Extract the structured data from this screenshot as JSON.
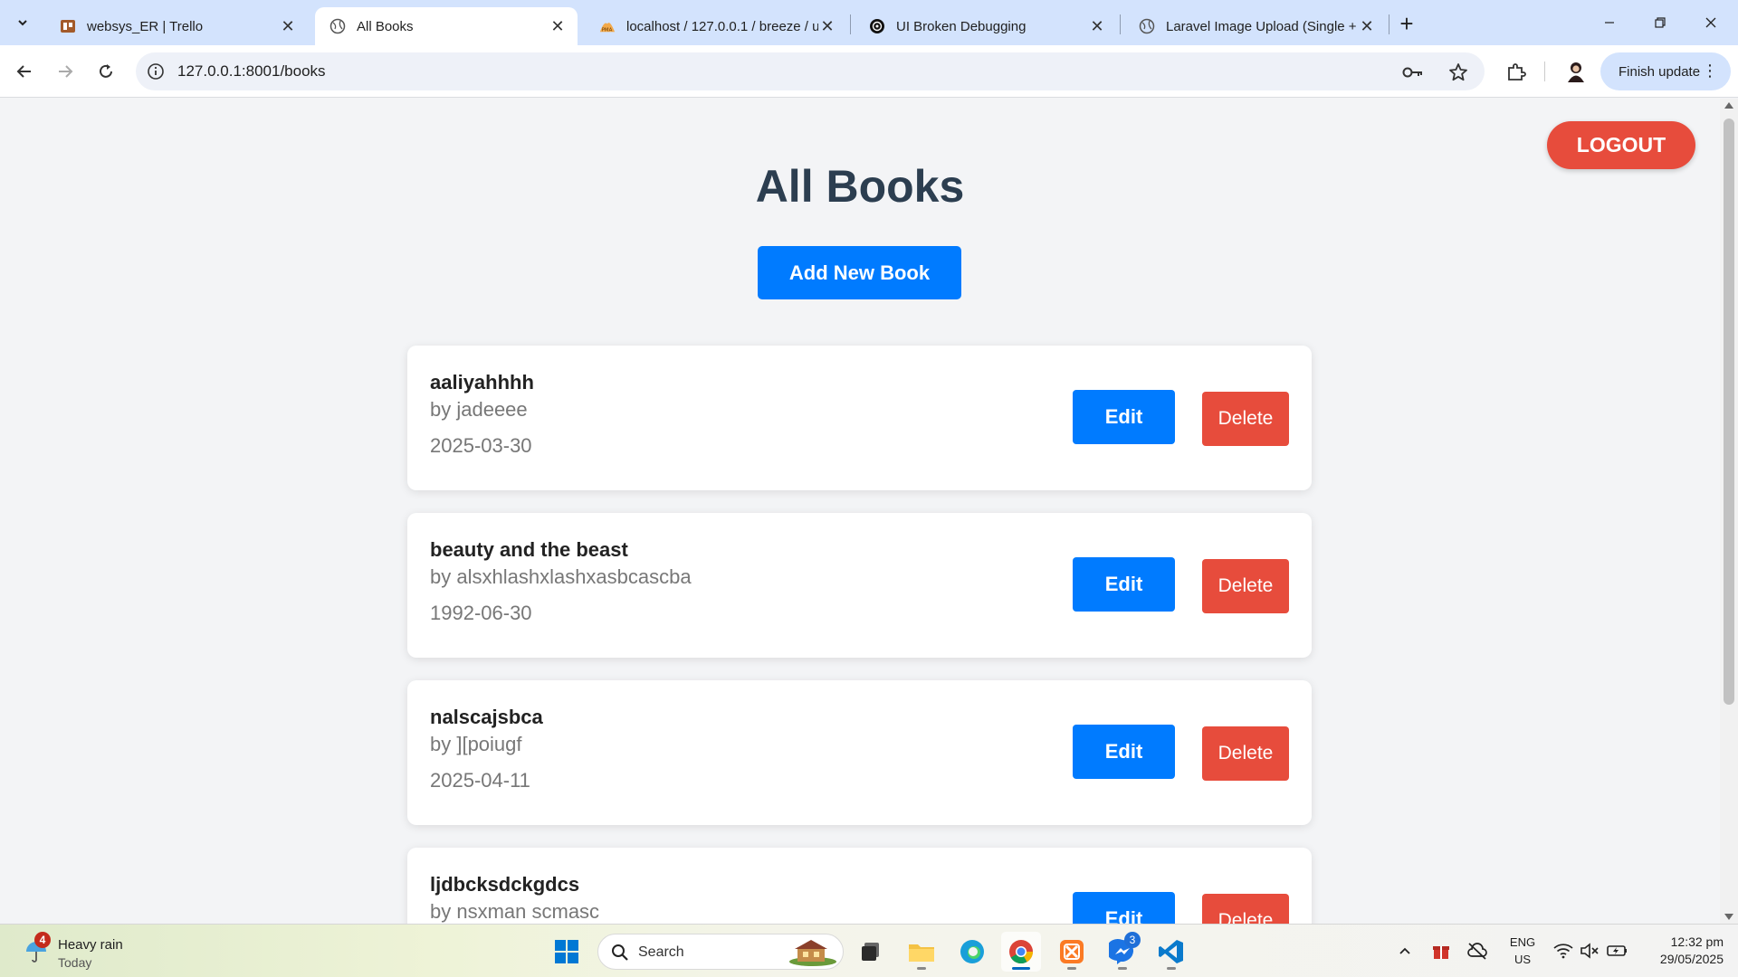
{
  "browser": {
    "tabs": [
      {
        "title": "websys_ER | Trello",
        "icon": "trello-icon"
      },
      {
        "title": "All Books",
        "icon": "globe-icon",
        "active": true
      },
      {
        "title": "localhost / 127.0.0.1 / breeze / u",
        "icon": "phpmyadmin-icon"
      },
      {
        "title": "UI Broken Debugging",
        "icon": "chatgpt-icon"
      },
      {
        "title": "Laravel Image Upload (Single +",
        "icon": "globe-icon"
      }
    ],
    "url": "127.0.0.1:8001/books",
    "finish_update_label": "Finish update"
  },
  "page": {
    "logout_label": "LOGOUT",
    "title": "All Books",
    "add_button_label": "Add New Book",
    "edit_label": "Edit",
    "delete_label": "Delete",
    "books": [
      {
        "title": "aaliyahhhh",
        "author": "by jadeeee",
        "date": "2025-03-30"
      },
      {
        "title": "beauty and the beast",
        "author": "by alsxhlashxlashxasbcascba",
        "date": "1992-06-30"
      },
      {
        "title": "nalscajsbca",
        "author": "by ][poiugf",
        "date": "2025-04-11"
      },
      {
        "title": "ljdbcksdckgdcs",
        "author": "by nsxman scmasc",
        "date": ""
      }
    ],
    "colors": {
      "primary": "#007bff",
      "danger": "#e74c3c",
      "heading": "#2c3e50"
    }
  },
  "taskbar": {
    "weather": {
      "badge": "4",
      "condition": "Heavy rain",
      "when": "Today"
    },
    "search_placeholder": "Search",
    "messenger_badge": "3",
    "language": {
      "lang": "ENG",
      "region": "US"
    },
    "clock": {
      "time": "12:32 pm",
      "date": "29/05/2025"
    }
  }
}
